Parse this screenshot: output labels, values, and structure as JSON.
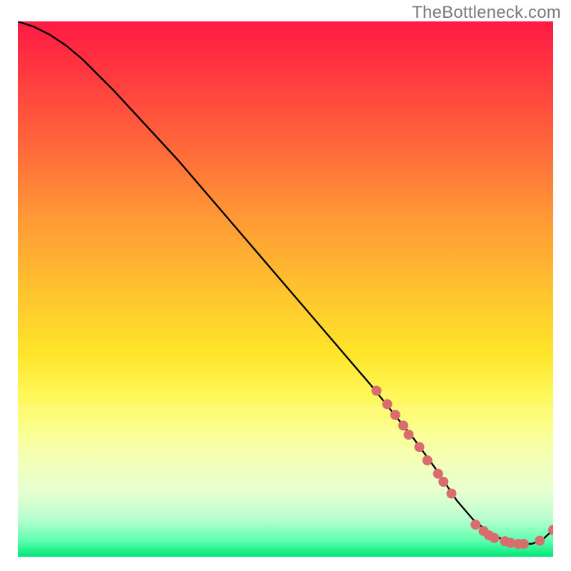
{
  "watermark": "TheBottleneck.com",
  "chart_data": {
    "type": "line",
    "title": "",
    "xlabel": "",
    "ylabel": "",
    "xlim": [
      0,
      100
    ],
    "ylim": [
      0,
      100
    ],
    "grid": false,
    "legend": false,
    "series": [
      {
        "name": "bottleneck-curve",
        "x": [
          0,
          3,
          6,
          9,
          12,
          18,
          24,
          30,
          36,
          42,
          48,
          54,
          60,
          66,
          70,
          74,
          78,
          82,
          85,
          88,
          91,
          94,
          96,
          98,
          100
        ],
        "values": [
          100,
          99,
          97.5,
          95.5,
          93,
          87,
          80.5,
          74,
          67,
          60,
          53,
          46,
          39,
          32,
          27,
          22,
          16.5,
          10.5,
          7,
          4.5,
          3,
          2.4,
          2.4,
          3.2,
          5
        ]
      }
    ],
    "markers": {
      "name": "highlight-points",
      "color": "#d96c6c",
      "points": [
        {
          "x": 67.0,
          "y": 31.0
        },
        {
          "x": 69.0,
          "y": 28.5
        },
        {
          "x": 70.5,
          "y": 26.5
        },
        {
          "x": 72.0,
          "y": 24.5
        },
        {
          "x": 73.0,
          "y": 22.8
        },
        {
          "x": 75.0,
          "y": 20.5
        },
        {
          "x": 76.5,
          "y": 18.0
        },
        {
          "x": 78.5,
          "y": 15.5
        },
        {
          "x": 79.5,
          "y": 14.0
        },
        {
          "x": 81.0,
          "y": 11.8
        },
        {
          "x": 85.5,
          "y": 6.0
        },
        {
          "x": 87.0,
          "y": 4.8
        },
        {
          "x": 88.0,
          "y": 4.0
        },
        {
          "x": 89.0,
          "y": 3.5
        },
        {
          "x": 91.0,
          "y": 2.9
        },
        {
          "x": 92.0,
          "y": 2.6
        },
        {
          "x": 93.5,
          "y": 2.4
        },
        {
          "x": 94.5,
          "y": 2.4
        },
        {
          "x": 97.5,
          "y": 3.0
        },
        {
          "x": 100.0,
          "y": 5.0
        }
      ]
    }
  },
  "colors": {
    "curve": "#000000",
    "marker": "#d96c6c",
    "watermark": "#7a7a7a"
  }
}
